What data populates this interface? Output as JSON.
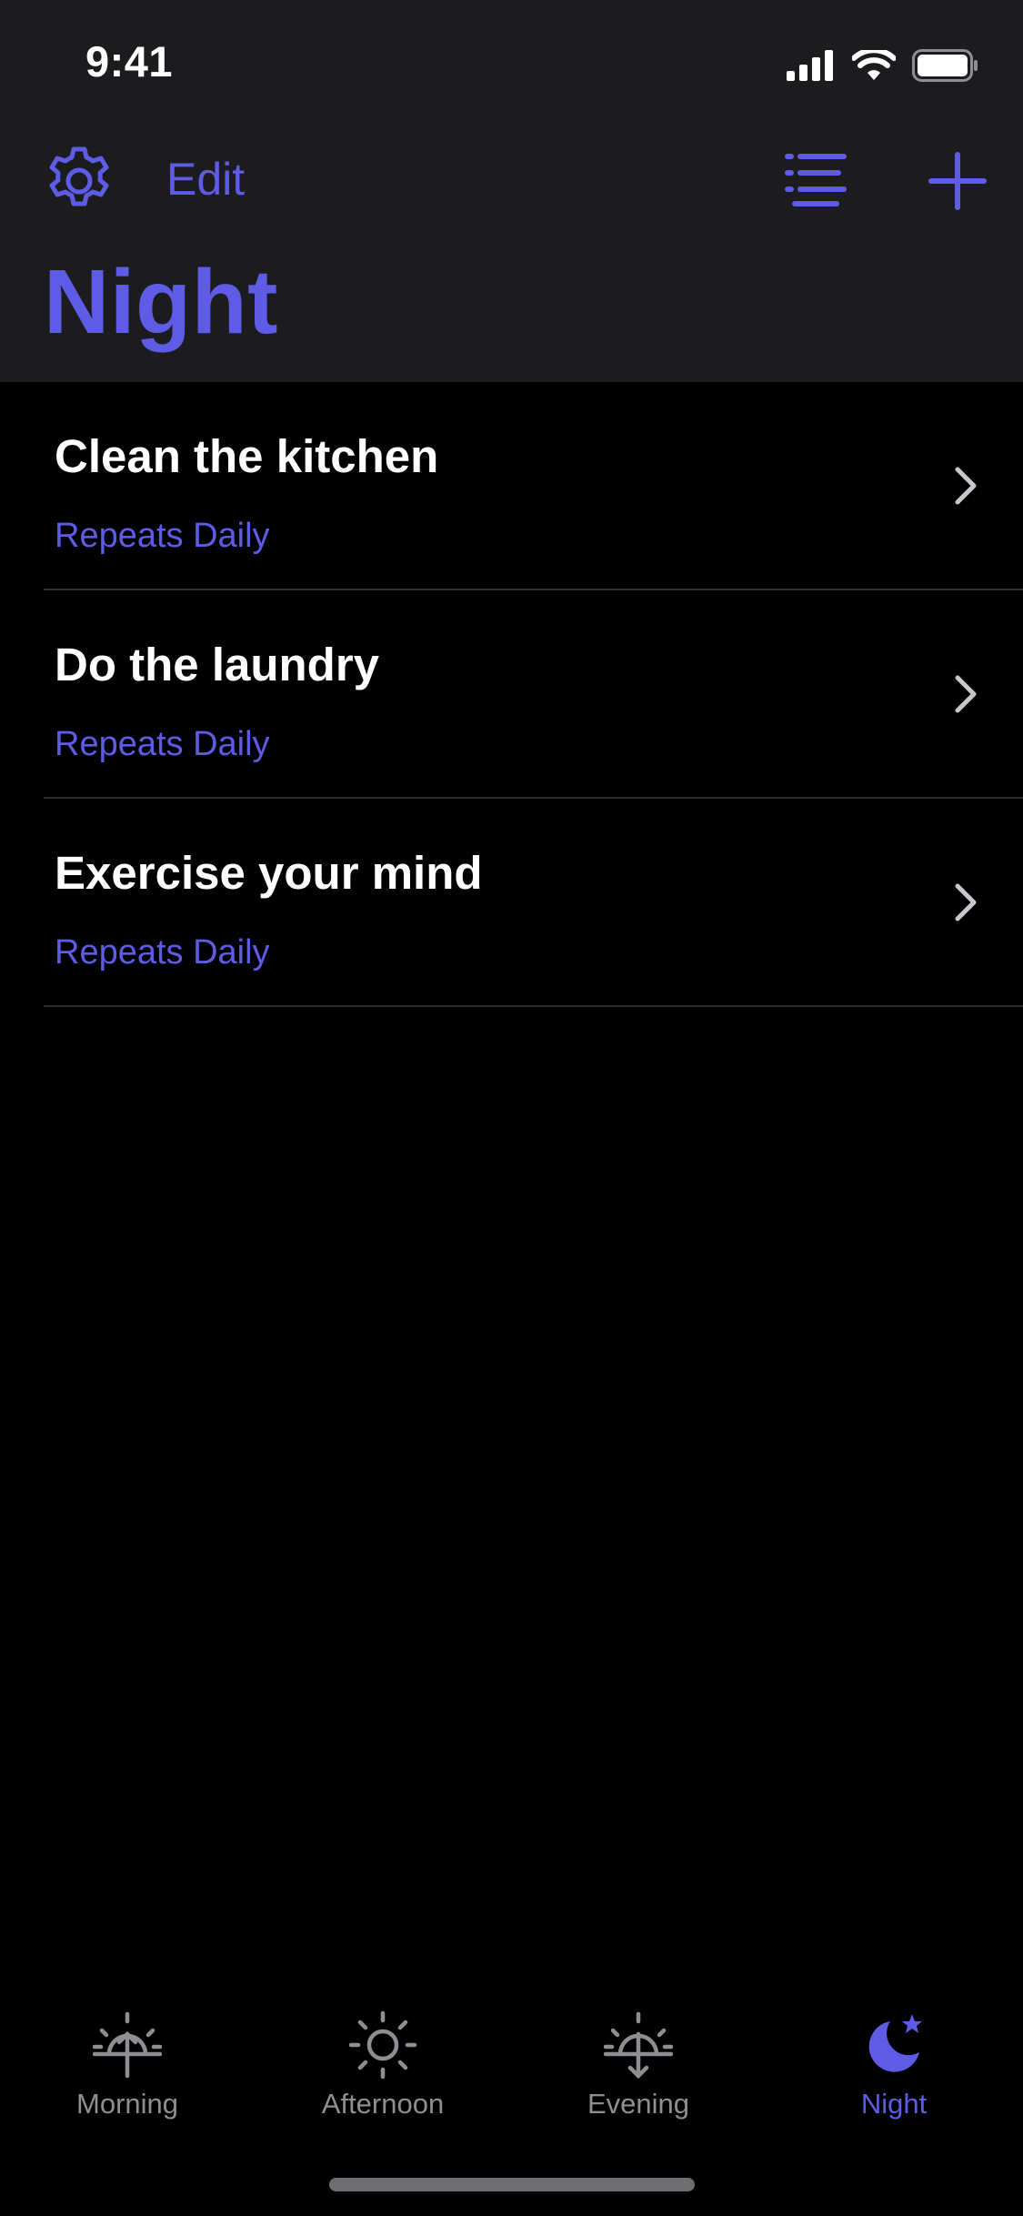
{
  "colors": {
    "accent": "#5e5ce6",
    "header_bg": "#1c1c1e",
    "background": "#000000",
    "text_primary": "#ffffff",
    "tab_inactive": "#8e8e93",
    "separator": "#2e2e30"
  },
  "status_bar": {
    "time": "9:41",
    "icons": [
      "cellular-signal-icon",
      "wifi-icon",
      "battery-icon"
    ]
  },
  "nav": {
    "settings_icon": "gear-icon",
    "edit_label": "Edit",
    "list_icon": "list-icon",
    "add_icon": "plus-icon"
  },
  "page": {
    "title": "Night"
  },
  "tasks": [
    {
      "title": "Clean the kitchen",
      "subtitle": "Repeats Daily"
    },
    {
      "title": "Do the laundry",
      "subtitle": "Repeats Daily"
    },
    {
      "title": "Exercise your mind",
      "subtitle": "Repeats Daily"
    }
  ],
  "tab_bar": {
    "items": [
      {
        "label": "Morning",
        "icon": "sunrise-icon",
        "active": false
      },
      {
        "label": "Afternoon",
        "icon": "sun-icon",
        "active": false
      },
      {
        "label": "Evening",
        "icon": "sunset-icon",
        "active": false
      },
      {
        "label": "Night",
        "icon": "moon-star-icon",
        "active": true
      }
    ]
  }
}
